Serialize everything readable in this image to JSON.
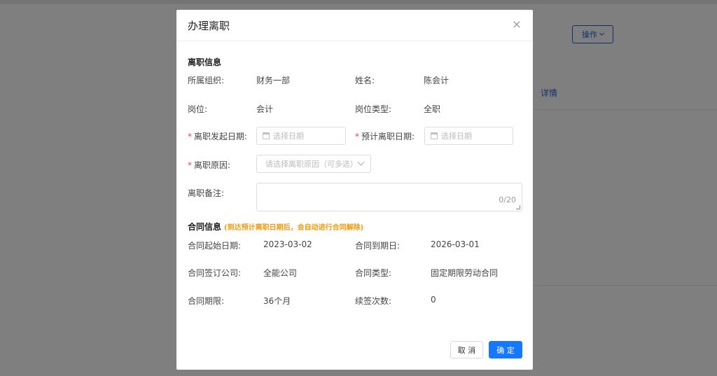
{
  "background": {
    "operate_label": "操作",
    "detail_link": "详情"
  },
  "modal": {
    "title": "办理离职",
    "close_glyph": "×",
    "resign_section": {
      "title": "离职信息",
      "org_label": "所属组织:",
      "org_value": "财务一部",
      "name_label": "姓名:",
      "name_value": "陈会计",
      "position_label": "岗位:",
      "position_value": "会计",
      "position_type_label": "岗位类型:",
      "position_type_value": "全职",
      "required_mark": "*",
      "start_date_label": "离职发起日期:",
      "start_date_placeholder": "选择日期",
      "expected_date_label": "预计离职日期:",
      "expected_date_placeholder": "选择日期",
      "reason_label": "离职原因:",
      "reason_placeholder": "请选择离职原因（可多选）",
      "remark_label": "离职备注:",
      "remark_value": "",
      "remark_count": "0/20"
    },
    "contract_section": {
      "title": "合同信息",
      "note": "(到达预计离职日期后，会自动进行合同解除)",
      "start_label": "合同起始日期:",
      "start_value": "2023-03-02",
      "end_label": "合同到期日:",
      "end_value": "2026-03-01",
      "company_label": "合同签订公司:",
      "company_value": "全能公司",
      "type_label": "合同类型:",
      "type_value": "固定期限劳动合同",
      "term_label": "合同期限:",
      "term_value": "36个月",
      "renewals_label": "续签次数:",
      "renewals_value": "0"
    },
    "footer": {
      "cancel_label": "取 消",
      "ok_label": "确 定"
    }
  },
  "colors": {
    "primary": "#1677ff",
    "required": "#e54545",
    "note": "#f29b0f",
    "overlay": "rgba(0,0,0,0.5)"
  },
  "icons": [
    "close-icon",
    "calendar-icon",
    "chevron-down-icon"
  ]
}
